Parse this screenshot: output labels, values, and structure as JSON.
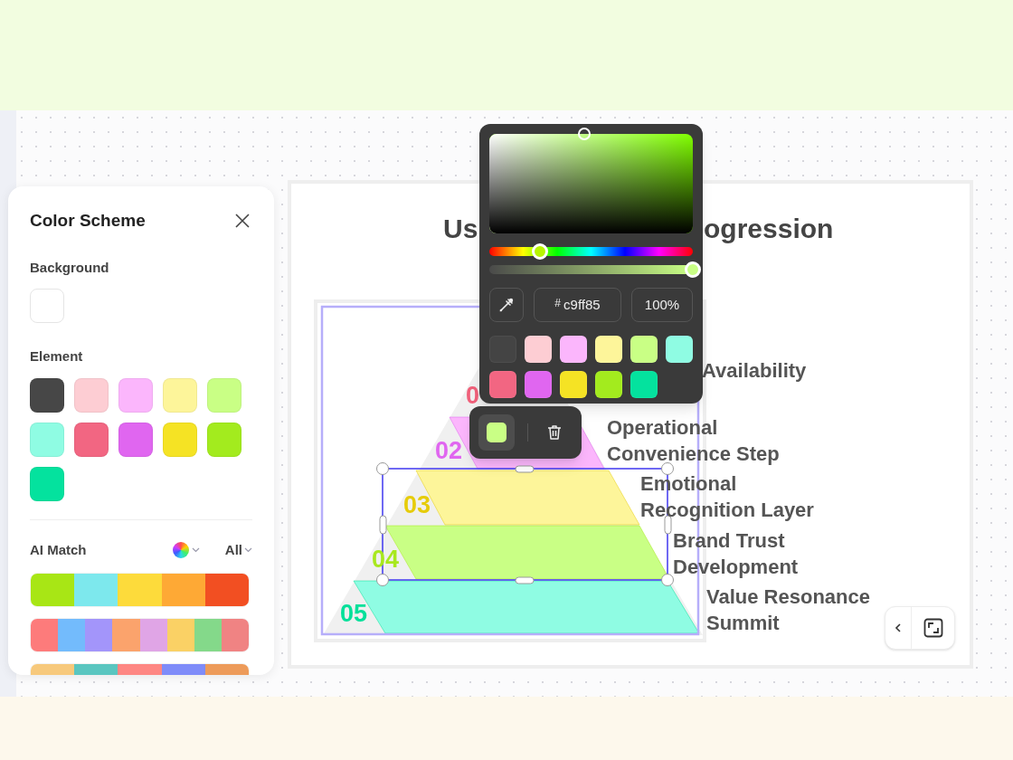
{
  "color_scheme_panel": {
    "title": "Color Scheme",
    "background_label": "Background",
    "background_swatch": {
      "color": "#ffffff"
    },
    "element_label": "Element",
    "element_swatches": [
      {
        "color": "#474747"
      },
      {
        "color": "#fdcdd3"
      },
      {
        "color": "#fbb6fc"
      },
      {
        "color": "#fdf59a"
      },
      {
        "color": "#c9ff85"
      },
      {
        "color": "#8ffce3"
      },
      {
        "color": "#f26682"
      },
      {
        "color": "#e066f0"
      },
      {
        "color": "#f5e324"
      },
      {
        "color": "#a3eb1e"
      },
      {
        "color": "#04e29e"
      }
    ],
    "ai_match_label": "AI Match",
    "filter_label": "All",
    "palettes": [
      {
        "colors": [
          {
            "color": "#a8e615"
          },
          {
            "color": "#7de8ed"
          },
          {
            "color": "#fddb3b"
          },
          {
            "color": "#fea935"
          },
          {
            "color": "#f24f22"
          }
        ]
      },
      {
        "colors": [
          {
            "color": "#fd7b7b"
          },
          {
            "color": "#73bbfc"
          },
          {
            "color": "#a395fa"
          },
          {
            "color": "#fba36c"
          },
          {
            "color": "#e0a5e6"
          },
          {
            "color": "#fad165"
          },
          {
            "color": "#84d98a"
          },
          {
            "color": "#f08383"
          }
        ]
      },
      {
        "colors": [
          {
            "color": "#f7c97c"
          },
          {
            "color": "#5ac6c0"
          },
          {
            "color": "#fe8783"
          },
          {
            "color": "#7f8cf9"
          },
          {
            "color": "#ed9b5a"
          }
        ]
      }
    ]
  },
  "diagram": {
    "title_fragments": [
      "Us",
      "ogression"
    ],
    "layers": [
      {
        "number": "0",
        "color": "#f0607a",
        "label_lines": [
          "Availability"
        ]
      },
      {
        "number": "02",
        "color": "#e066f0",
        "shape": {
          "color": "#fbb6fc"
        },
        "label_lines": [
          "Operational",
          "Convenience Step"
        ]
      },
      {
        "number": "03",
        "color": "#e6cc0a",
        "shape": {
          "color": "#fdf59a"
        },
        "label_lines": [
          "Emotional",
          "Recognition Layer"
        ]
      },
      {
        "number": "04",
        "color": "#a8e81e",
        "shape": {
          "color": "#c9ff85"
        },
        "label_lines": [
          "Brand Trust",
          "Development"
        ]
      },
      {
        "number": "05",
        "color": "#05e09a",
        "shape": {
          "color": "#8ffce3"
        },
        "label_lines": [
          "Value Resonance",
          "Summit"
        ]
      }
    ]
  },
  "color_picker": {
    "hue_slider": {
      "level": 0.25
    },
    "alpha_slider": {
      "level": 1
    },
    "hash_sign": "#",
    "hex": "c9ff85",
    "opacity": "100%",
    "swatches": [
      {
        "color": "#444444"
      },
      {
        "color": "#fdcdd3"
      },
      {
        "color": "#fbb6fc"
      },
      {
        "color": "#fdf59a"
      },
      {
        "color": "#c9ff85"
      },
      {
        "color": "#8ffce3"
      },
      {
        "color": "#f26682"
      },
      {
        "color": "#e066f0"
      },
      {
        "color": "#f5e324"
      },
      {
        "color": "#a3eb1e"
      },
      {
        "color": "#04e29e"
      }
    ]
  },
  "selection_toolbar": {
    "fill_swatch": {
      "color": "#c9ff85"
    }
  }
}
